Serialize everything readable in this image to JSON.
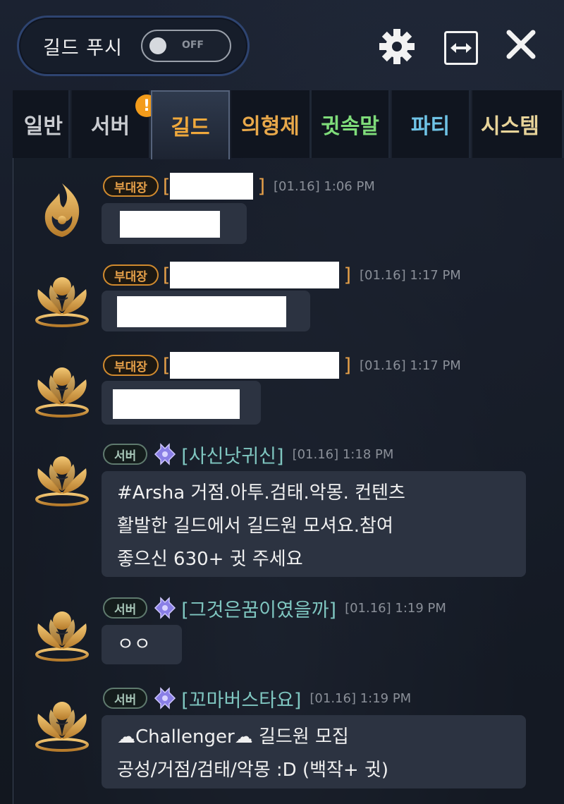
{
  "header": {
    "push_label": "길드 푸시",
    "toggle_state": "OFF",
    "icons": [
      "gear-icon",
      "expand-icon",
      "close-icon"
    ]
  },
  "tabs": [
    {
      "label": "일반",
      "color": "#c9cbd0",
      "active": false
    },
    {
      "label": "서버",
      "color": "#c9cbd0",
      "active": false,
      "alert": "!"
    },
    {
      "label": "길드",
      "color": "#f0a93c",
      "active": true
    },
    {
      "label": "의형제",
      "color": "#e8a84a",
      "active": false
    },
    {
      "label": "귓속말",
      "color": "#7fdc7a",
      "active": false
    },
    {
      "label": "파티",
      "color": "#6fc3e6",
      "active": false
    },
    {
      "label": "시스템",
      "color": "#e8d49a",
      "active": false
    }
  ],
  "messages": [
    {
      "rank": "부대장",
      "name_open": "[",
      "name_close": "]",
      "time": "[01.16] 1:06 PM",
      "avatar": "flame-emblem-icon",
      "text": ""
    },
    {
      "rank": "부대장",
      "name_open": "[",
      "name_close": "]",
      "time": "[01.16] 1:17 PM",
      "avatar": "lotus-emblem-icon",
      "text": ""
    },
    {
      "rank": "부대장",
      "name_open": "[",
      "name_close": "]",
      "time": "[01.16] 1:17 PM",
      "avatar": "lotus-emblem-icon",
      "text": ""
    },
    {
      "rank": "서버",
      "name": "[사신낫귀신]",
      "time": "[01.16] 1:18 PM",
      "avatar": "lotus-emblem-icon",
      "lines": [
        "#Arsha 거점.아투.검태.악몽. 컨텐츠",
        "활발한 길드에서 길드원 모셔요.참여",
        "좋으신 630+ 귓 주세요"
      ]
    },
    {
      "rank": "서버",
      "name": "[그것은꿈이였을까]",
      "time": "[01.16] 1:19 PM",
      "avatar": "lotus-emblem-icon",
      "lines": [
        "ㅇㅇ"
      ]
    },
    {
      "rank": "서버",
      "name": "[꼬마버스타요]",
      "time": "[01.16] 1:19 PM",
      "avatar": "lotus-emblem-icon",
      "lines": [
        "☁Challenger☁ 길드원 모집",
        "공성/거점/검태/악몽 :D (백작+ 귓)"
      ]
    }
  ]
}
